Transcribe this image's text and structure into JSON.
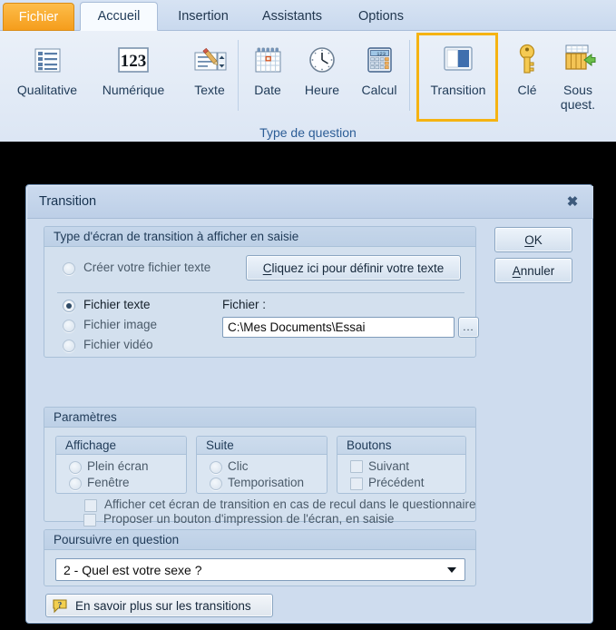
{
  "ribbon": {
    "tabs": [
      {
        "label": "Fichier",
        "state": "file"
      },
      {
        "label": "Accueil",
        "state": "active"
      },
      {
        "label": "Insertion",
        "state": "normal"
      },
      {
        "label": "Assistants",
        "state": "normal"
      },
      {
        "label": "Options",
        "state": "normal"
      }
    ],
    "group_label": "Type de question",
    "buttons": [
      {
        "label": "Qualitative",
        "icon": "list-lines-icon"
      },
      {
        "label": "Numérique",
        "icon": "numeric-123-icon"
      },
      {
        "label": "Texte",
        "icon": "text-pencil-icon"
      },
      {
        "label": "Date",
        "icon": "calendar-icon"
      },
      {
        "label": "Heure",
        "icon": "clock-icon"
      },
      {
        "label": "Calcul",
        "icon": "calculator-icon"
      },
      {
        "label": "Transition",
        "icon": "transition-screen-icon"
      },
      {
        "label": "Clé",
        "icon": "key-icon"
      },
      {
        "label": "Sous\nquest.",
        "icon": "subquestion-table-icon"
      }
    ],
    "selected_button": "Transition",
    "highlight_color": "#f5b312"
  },
  "dialog": {
    "title": "Transition",
    "close_label": "✖",
    "ok_label_pre": "O",
    "ok_label_post": "K",
    "cancel_label_pre": "A",
    "cancel_label_post": "nnuler",
    "group_screen_type": {
      "title": "Type d'écran de transition à afficher en saisie",
      "radio_create": "Créer votre fichier texte",
      "button_define_pre": "C",
      "button_define_post": "liquez ici pour définir votre texte",
      "radio_text_file": "Fichier texte",
      "radio_image_file": "Fichier image",
      "radio_video_file": "Fichier vidéo",
      "selected_radio": "Fichier texte",
      "file_label": "Fichier :",
      "file_value": "C:\\Mes Documents\\Essai",
      "browse_label": "..."
    },
    "group_parameters": {
      "title": "Paramètres",
      "display": {
        "title": "Affichage",
        "options": [
          "Plein écran",
          "Fenêtre"
        ],
        "selected": ""
      },
      "next": {
        "title": "Suite",
        "options": [
          "Clic",
          "Temporisation"
        ],
        "selected": ""
      },
      "buttons": {
        "title": "Boutons",
        "options": [
          "Suivant",
          "Précédent"
        ],
        "checked": []
      },
      "checkbox_back": "Afficher cet écran de transition en cas de recul dans le questionnaire",
      "checkbox_print": "Proposer un bouton d'impression de l'écran, en saisie"
    },
    "group_continue": {
      "title": "Poursuivre en question",
      "selected_option": "2 - Quel est votre sexe ?"
    },
    "learn_more_button": "En savoir plus sur les transitions",
    "learn_more_icon": "help-bubble-icon"
  }
}
